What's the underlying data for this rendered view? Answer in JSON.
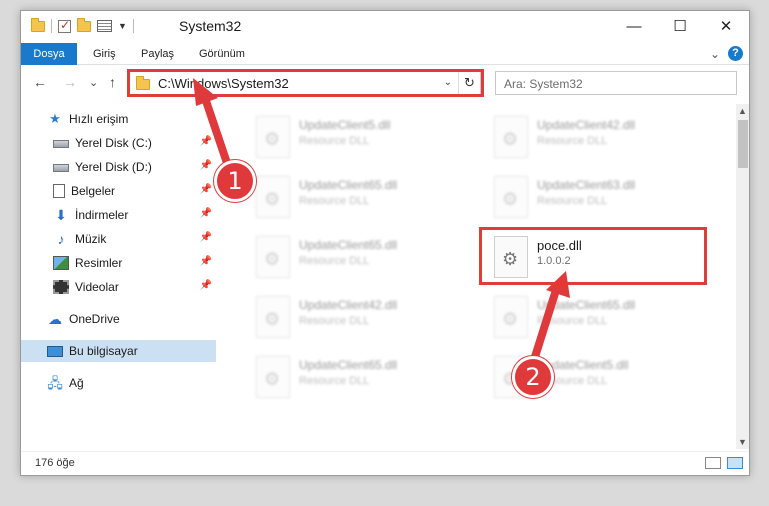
{
  "window": {
    "title": "System32",
    "minimize": "—",
    "maximize": "☐",
    "close": "✕"
  },
  "ribbon": {
    "tabs": [
      "Dosya",
      "Giriş",
      "Paylaş",
      "Görünüm"
    ],
    "help": "?",
    "collapse": "⌄"
  },
  "nav": {
    "back": "←",
    "forward": "→",
    "recent": "⌄",
    "up": "↑",
    "address": "C:\\Windows\\System32",
    "address_dropdown": "⌄",
    "refresh": "↻",
    "search_placeholder": "Ara: System32"
  },
  "sidebar": {
    "items": [
      {
        "label": "Hızlı erişim",
        "icon": "star-icon",
        "pinned": false
      },
      {
        "label": "Yerel Disk (C:)",
        "icon": "drive-icon",
        "pinned": true
      },
      {
        "label": "Yerel Disk (D:)",
        "icon": "drive-icon",
        "pinned": true
      },
      {
        "label": "Belgeler",
        "icon": "documents-icon",
        "pinned": true
      },
      {
        "label": "İndirmeler",
        "icon": "download-icon",
        "pinned": true
      },
      {
        "label": "Müzik",
        "icon": "music-icon",
        "pinned": true
      },
      {
        "label": "Resimler",
        "icon": "pictures-icon",
        "pinned": true
      },
      {
        "label": "Videolar",
        "icon": "video-icon",
        "pinned": true
      },
      {
        "label": "OneDrive",
        "icon": "cloud-icon",
        "pinned": false
      },
      {
        "label": "Bu bilgisayar",
        "icon": "computer-icon",
        "pinned": false,
        "selected": true
      },
      {
        "label": "Ağ",
        "icon": "network-icon",
        "pinned": false
      }
    ]
  },
  "files": [
    {
      "name": "UpdateClient5.dll",
      "desc": "Resource DLL"
    },
    {
      "name": "UpdateClient42.dll",
      "desc": "Resource DLL"
    },
    {
      "name": "UpdateClient65.dll",
      "desc": "Resource DLL"
    },
    {
      "name": "UpdateClient63.dll",
      "desc": "Resource DLL"
    },
    {
      "name": "UpdateClient65.dll",
      "desc": "Resource DLL"
    },
    {
      "name": "poce.dll",
      "desc": "1.0.0.2"
    },
    {
      "name": "UpdateClient42.dll",
      "desc": "Resource DLL"
    },
    {
      "name": "UpdateClient65.dll",
      "desc": "Resource DLL"
    },
    {
      "name": "UpdateClient65.dll",
      "desc": "Resource DLL"
    },
    {
      "name": "UpdateClient5.dll",
      "desc": "Resource DLL"
    }
  ],
  "status": {
    "count": "176 öğe"
  },
  "callouts": {
    "one": "1",
    "two": "2"
  },
  "colors": {
    "accent": "#1979ca",
    "highlight": "#e03c3c",
    "selected": "#cce0f3"
  }
}
